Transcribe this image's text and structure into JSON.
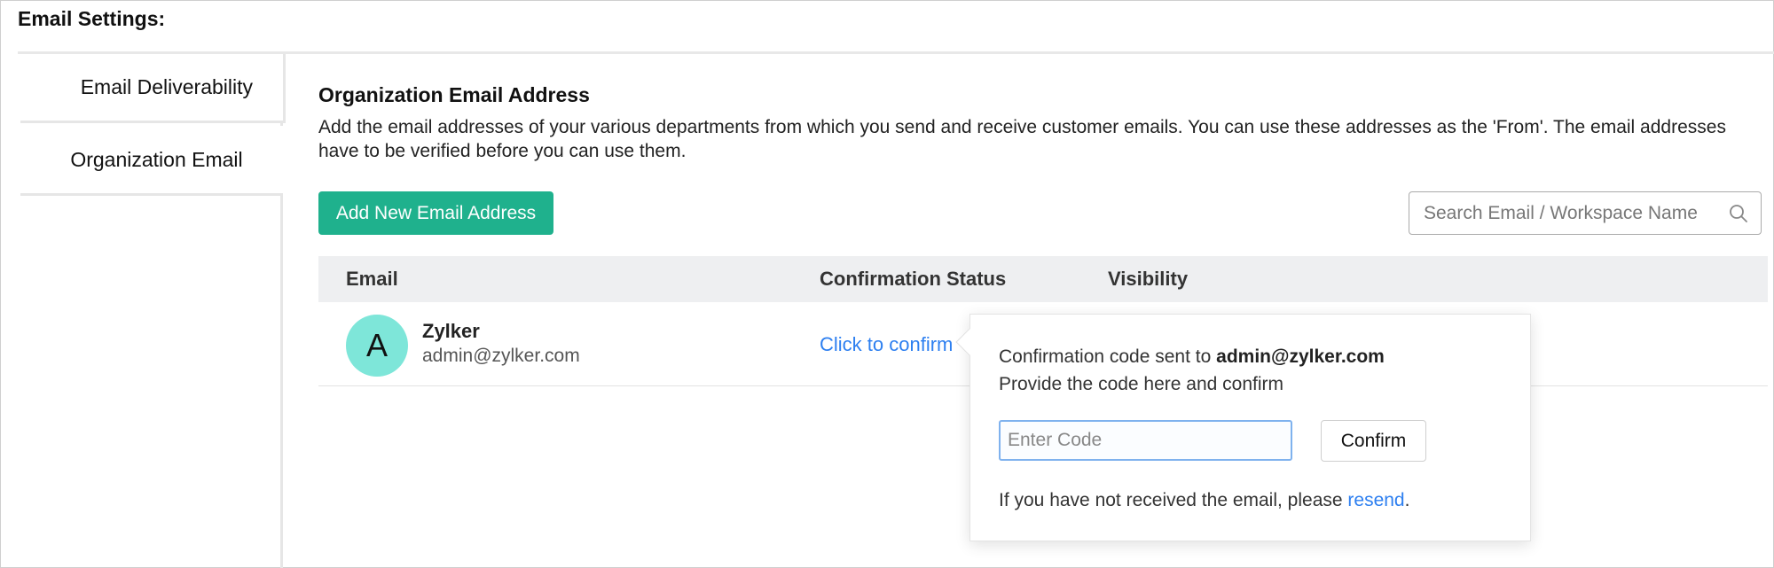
{
  "page": {
    "title": "Email Settings:"
  },
  "nav": {
    "items": [
      {
        "label": "Email Deliverability"
      },
      {
        "label": "Organization Email"
      }
    ]
  },
  "section": {
    "title": "Organization Email Address",
    "description": "Add the email addresses of your various departments from which you send and receive customer emails. You can use these addresses as the 'From'. The email addresses have to be verified before you can use them."
  },
  "toolbar": {
    "add_label": "Add New Email Address",
    "search_placeholder": "Search Email / Workspace Name"
  },
  "table": {
    "headers": {
      "email": "Email",
      "status": "Confirmation Status",
      "visibility": "Visibility"
    },
    "rows": [
      {
        "avatar_letter": "A",
        "name": "Zylker",
        "email": "admin@zylker.com",
        "status": "Click to confirm"
      }
    ]
  },
  "popover": {
    "line1_prefix": "Confirmation code sent to ",
    "line1_email": "admin@zylker.com",
    "line2": "Provide the code here and confirm",
    "code_placeholder": "Enter Code",
    "confirm_label": "Confirm",
    "footer_prefix": "If you have not received the email, please ",
    "resend_label": "resend",
    "footer_suffix": "."
  },
  "colors": {
    "accent": "#1fb18d",
    "link": "#2d7ff0",
    "avatar_bg": "#7ee6d9",
    "table_header_bg": "#eeeff1"
  },
  "icons": {
    "search": "search-icon"
  }
}
